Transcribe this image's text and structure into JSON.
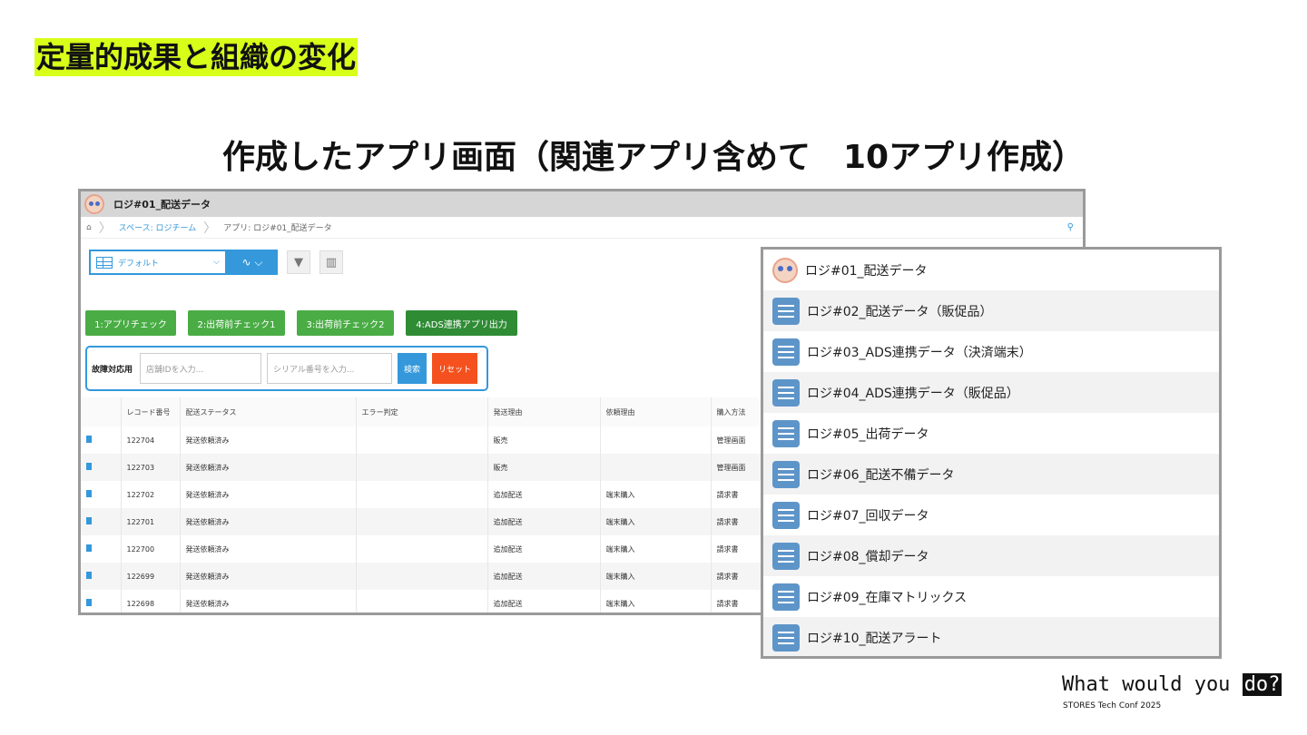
{
  "slide": {
    "title": "定量的成果と組織の変化",
    "heading": "作成したアプリ画面（関連アプリ含めて　10アプリ作成）"
  },
  "app": {
    "name": "ロジ#01_配送データ",
    "breadcrumb": {
      "space": "スペース: ロジチーム",
      "app": "アプリ: ロジ#01_配送データ"
    },
    "view": "デフォルト",
    "buttons": [
      "1:アプリチェック",
      "2:出荷前チェック1",
      "3:出荷前チェック2",
      "4:ADS連携アプリ出力"
    ],
    "search": {
      "label": "故障対応用",
      "store_placeholder": "店舗IDを入力...",
      "serial_placeholder": "シリアル番号を入力...",
      "search": "検索",
      "reset": "リセット"
    },
    "columns": [
      "レコード番号",
      "配送ステータス",
      "エラー判定",
      "発送理由",
      "依頼理由",
      "購入方法"
    ],
    "rows": [
      [
        "122704",
        "発送依頼済み",
        "",
        "販売",
        "",
        "管理画面"
      ],
      [
        "122703",
        "発送依頼済み",
        "",
        "販売",
        "",
        "管理画面"
      ],
      [
        "122702",
        "発送依頼済み",
        "",
        "追加配送",
        "端末購入",
        "請求書"
      ],
      [
        "122701",
        "発送依頼済み",
        "",
        "追加配送",
        "端末購入",
        "請求書"
      ],
      [
        "122700",
        "発送依頼済み",
        "",
        "追加配送",
        "端末購入",
        "請求書"
      ],
      [
        "122699",
        "発送依頼済み",
        "",
        "追加配送",
        "端末購入",
        "請求書"
      ],
      [
        "122698",
        "発送依頼済み",
        "",
        "追加配送",
        "端末購入",
        "請求書"
      ]
    ]
  },
  "related": [
    "ロジ#01_配送データ",
    "ロジ#02_配送データ（販促品）",
    "ロジ#03_ADS連携データ（決済端末）",
    "ロジ#04_ADS連携データ（販促品）",
    "ロジ#05_出荷データ",
    "ロジ#06_配送不備データ",
    "ロジ#07_回収データ",
    "ロジ#08_償却データ",
    "ロジ#09_在庫マトリックス",
    "ロジ#10_配送アラート"
  ],
  "brand": {
    "text": "What would you ",
    "highlight": "do?",
    "sub": "STORES Tech Conf 2025"
  }
}
